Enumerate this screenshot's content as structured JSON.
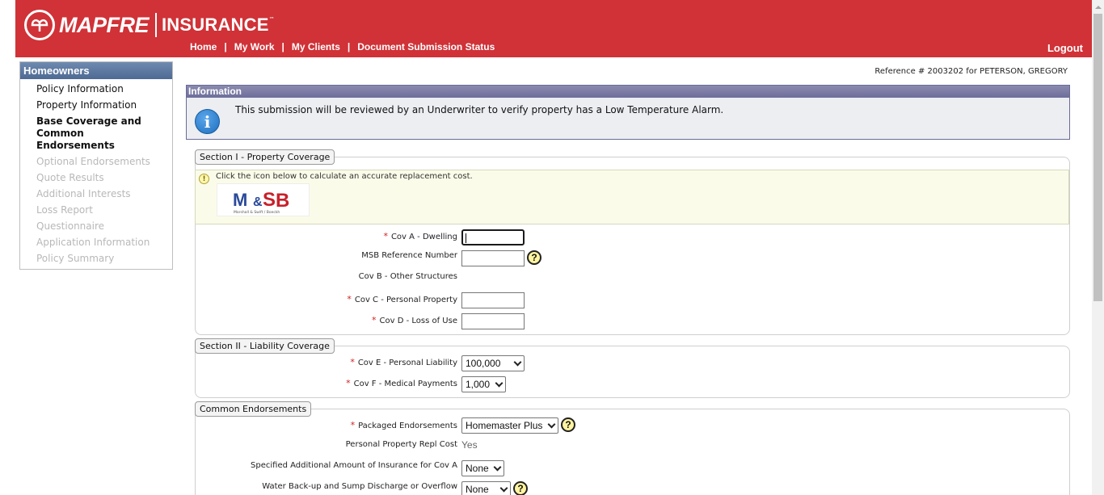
{
  "header": {
    "brand": "MAPFRE",
    "product": "INSURANCE",
    "trademark": "™",
    "nav": [
      "Home",
      "My Work",
      "My Clients",
      "Document Submission Status"
    ],
    "logout": "Logout",
    "color": "#d03237"
  },
  "sidebar": {
    "title": "Homeowners",
    "items": [
      {
        "label": "Policy Information",
        "state": "enabled"
      },
      {
        "label": "Property Information",
        "state": "enabled"
      },
      {
        "label": "Base Coverage and Common Endorsements",
        "state": "active"
      },
      {
        "label": "Optional Endorsements",
        "state": "disabled"
      },
      {
        "label": "Quote Results",
        "state": "disabled"
      },
      {
        "label": "Additional Interests",
        "state": "disabled"
      },
      {
        "label": "Loss Report",
        "state": "disabled"
      },
      {
        "label": "Questionnaire",
        "state": "disabled"
      },
      {
        "label": "Application Information",
        "state": "disabled"
      },
      {
        "label": "Policy Summary",
        "state": "disabled"
      }
    ]
  },
  "reference": "Reference # 2003202 for PETERSON, GREGORY",
  "info": {
    "title": "Information",
    "icon": "info-icon",
    "message": "This submission will be reviewed by an Underwriter to verify property has a Low Temperature Alarm."
  },
  "section1": {
    "title": "Section I - Property Coverage",
    "tip": "Click the icon below to calculate an accurate replacement cost.",
    "logo_text": "M&SB",
    "logo_caption": "Marshall & Swift / Boeckh",
    "fields": {
      "cov_a": {
        "label": "Cov A - Dwelling",
        "value": ""
      },
      "msb_ref": {
        "label": "MSB Reference Number",
        "value": ""
      },
      "cov_b": {
        "label": "Cov B - Other Structures"
      },
      "cov_c": {
        "label": "Cov C - Personal Property",
        "value": ""
      },
      "cov_d": {
        "label": "Cov D - Loss of Use",
        "value": ""
      }
    }
  },
  "section2": {
    "title": "Section II - Liability Coverage",
    "fields": {
      "cov_e": {
        "label": "Cov E - Personal Liability",
        "value": "100,000"
      },
      "cov_f": {
        "label": "Cov F - Medical Payments",
        "value": "1,000"
      }
    }
  },
  "section3": {
    "title": "Common Endorsements",
    "fields": {
      "packaged": {
        "label": "Packaged Endorsements",
        "value": "Homemaster Plus"
      },
      "ppr": {
        "label": "Personal Property Repl Cost",
        "value": "Yes"
      },
      "specified": {
        "label": "Specified Additional Amount of Insurance for Cov A",
        "value": "None"
      },
      "water": {
        "label": "Water Back-up and Sump Discharge or Overflow",
        "value": "None"
      }
    }
  },
  "required_mark": "*",
  "help_mark": "?"
}
